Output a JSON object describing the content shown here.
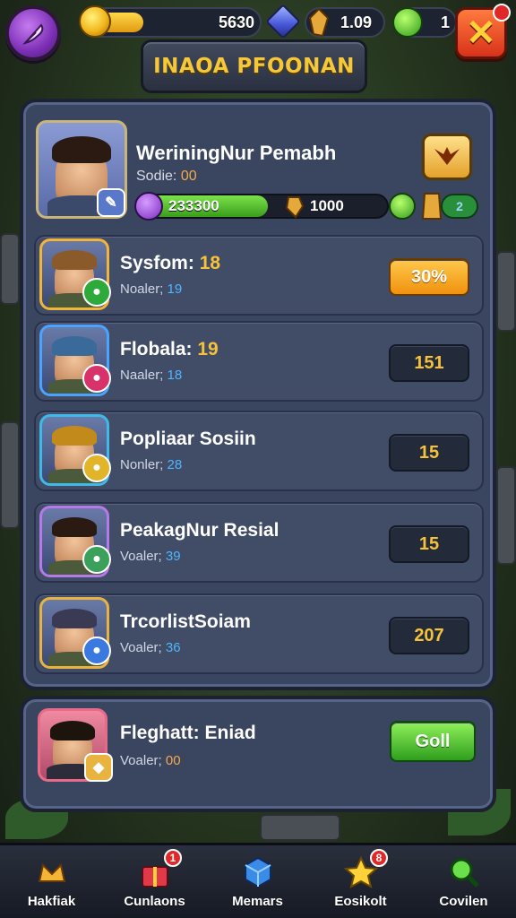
{
  "topbar": {
    "coins": "5630",
    "shards": "1.09",
    "energy": "1",
    "close_symbol": "✕"
  },
  "title": "INAOA PFOONAN",
  "profile": {
    "name": "WeriningNur Pemabh",
    "sub_label": "Sodie:",
    "sub_value": "00",
    "xp_value": "233300",
    "xp_progress": 0.52,
    "score": "1000",
    "mini_count": "2"
  },
  "rows": [
    {
      "name": "Sysfom:",
      "level": "18",
      "sub_label": "Noaler;",
      "sub_value": "19",
      "button": "30%",
      "button_style": "orange",
      "theme": "#f2b535"
    },
    {
      "name": "Flobala:",
      "level": "19",
      "sub_label": "Naaler;",
      "sub_value": "18",
      "button": "151",
      "button_style": "dark",
      "theme": "#4aa3ff"
    },
    {
      "name": "Popliaar Sosiin",
      "level": "",
      "sub_label": "Nonler;",
      "sub_value": "28",
      "button": "15",
      "button_style": "dark",
      "theme": "#3fb9e8"
    },
    {
      "name": "PeakagNur Resial",
      "level": "",
      "sub_label": "Voaler;",
      "sub_value": "39",
      "button": "15",
      "button_style": "dark",
      "theme": "#b57ae8"
    },
    {
      "name": "TrcorlistSoiam",
      "level": "",
      "sub_label": "Voaler;",
      "sub_value": "36",
      "button": "207",
      "button_style": "dark",
      "theme": "#e8b33f"
    }
  ],
  "featured": {
    "name": "Fleghatt: Eniad",
    "sub_label": "Voaler;",
    "sub_value": "00",
    "button": "Goll"
  },
  "nav": [
    {
      "label": "Hakfiak",
      "icon": "crown-icon",
      "badge": ""
    },
    {
      "label": "Cunlaons",
      "icon": "gift-icon",
      "badge": "1"
    },
    {
      "label": "Memars",
      "icon": "cube-icon",
      "badge": ""
    },
    {
      "label": "Eosikolt",
      "icon": "star-icon",
      "badge": "8"
    },
    {
      "label": "Covilen",
      "icon": "search-icon",
      "badge": ""
    }
  ]
}
